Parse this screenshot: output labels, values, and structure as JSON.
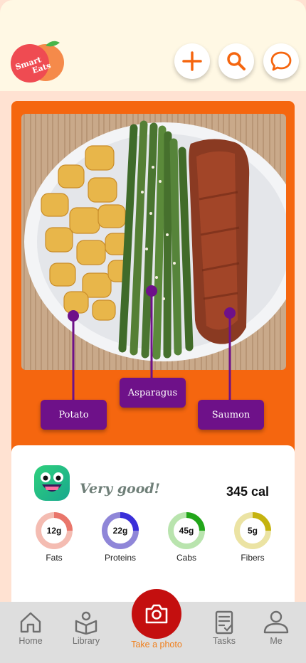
{
  "app": {
    "logo_text_line1": "Smart",
    "logo_text_line2": "Eats"
  },
  "header": {
    "actions": [
      {
        "icon": "plus-icon"
      },
      {
        "icon": "search-icon"
      },
      {
        "icon": "chat-bubble-icon"
      }
    ]
  },
  "photo": {
    "description_tags": {
      "potato": "Potato",
      "asparagus": "Asparagus",
      "salmon": "Saumon"
    }
  },
  "result": {
    "verdict": "Very good!",
    "calories": "345 cal",
    "nutrients": [
      {
        "label": "Fats",
        "value": "12g",
        "fraction": 0.25,
        "color": "#e9766b",
        "track": "#f4bcb2"
      },
      {
        "label": "Proteins",
        "value": "22g",
        "fraction": 0.25,
        "color": "#3a2fd9",
        "track": "#8f86d8"
      },
      {
        "label": "Cabs",
        "value": "45g",
        "fraction": 0.25,
        "color": "#22a61a",
        "track": "#b9e4ae"
      },
      {
        "label": "Fibers",
        "value": "5g",
        "fraction": 0.25,
        "color": "#c5b30f",
        "track": "#ebe3a3"
      }
    ]
  },
  "nav": {
    "home": "Home",
    "library": "Library",
    "take_photo": "Take a photo",
    "tasks": "Tasks",
    "me": "Me"
  },
  "colors": {
    "accent": "#f5660f",
    "tag": "#6e1189",
    "camera": "#c40f0f",
    "background": "#ffe2d2"
  }
}
